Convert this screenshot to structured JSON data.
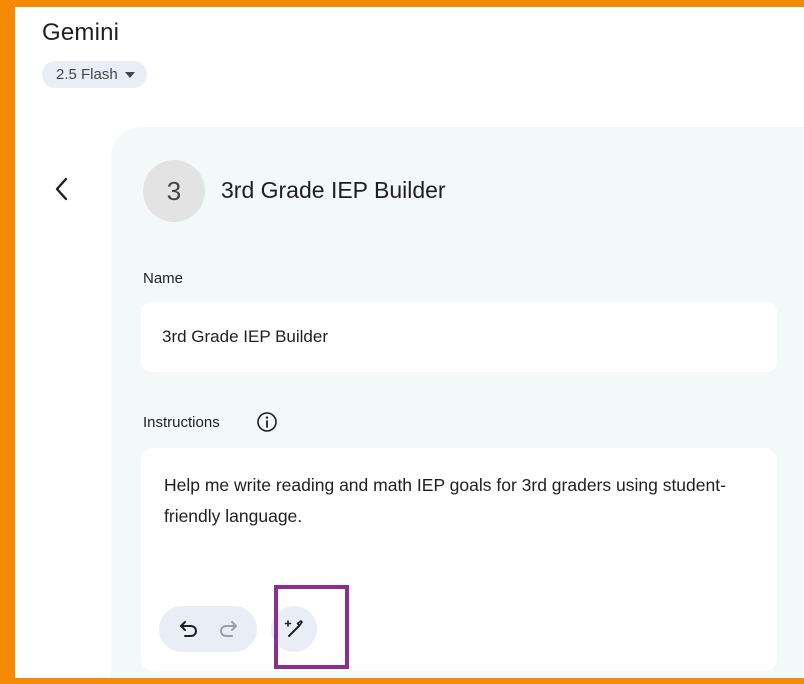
{
  "header": {
    "app_title": "Gemini",
    "model_label": "2.5 Flash"
  },
  "gem": {
    "avatar_letter": "3",
    "title": "3rd Grade IEP Builder"
  },
  "form": {
    "name_label": "Name",
    "name_value": "3rd Grade IEP Builder",
    "instructions_label": "Instructions",
    "instructions_value": "Help me write reading and math IEP goals for 3rd graders using student-friendly language."
  },
  "icons": {
    "back": "chevron-left-icon",
    "info": "info-icon",
    "undo": "undo-icon",
    "redo": "redo-icon",
    "magic": "magic-wand-icon",
    "dropdown": "caret-down-icon"
  },
  "colors": {
    "frame_border": "#f58a07",
    "highlight_border": "#8b2d91",
    "panel_background": "#f3f8f8",
    "chip_background": "#e9eef6"
  }
}
